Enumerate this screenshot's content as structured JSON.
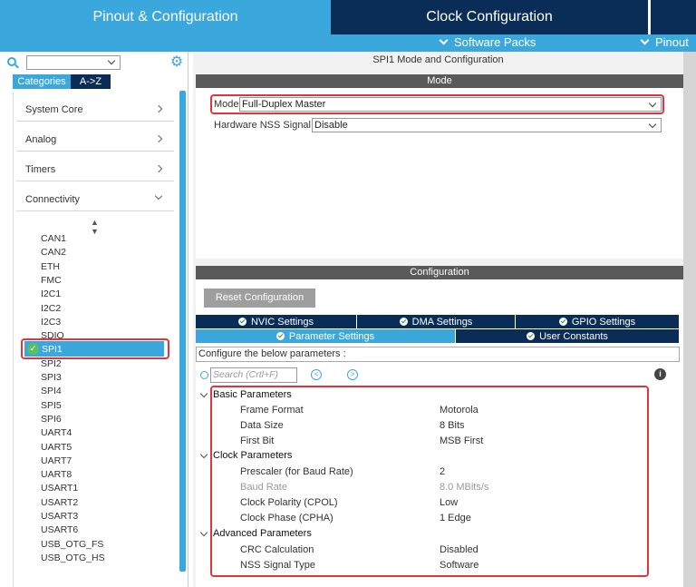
{
  "top_tabs": {
    "pinout": "Pinout & Configuration",
    "clock": "Clock Configuration"
  },
  "subbar": {
    "software_packs": "Software Packs",
    "pinout": "Pinout"
  },
  "left": {
    "categories_label": "Categories",
    "az_label": "A->Z",
    "categories": [
      "System Core",
      "Analog",
      "Timers",
      "Connectivity"
    ],
    "peripherals": [
      "CAN1",
      "CAN2",
      "ETH",
      "FMC",
      "I2C1",
      "I2C2",
      "I2C3",
      "SDIO",
      "SPI1",
      "SPI2",
      "SPI3",
      "SPI4",
      "SPI5",
      "SPI6",
      "UART4",
      "UART5",
      "UART7",
      "UART8",
      "USART1",
      "USART2",
      "USART3",
      "USART6",
      "USB_OTG_FS",
      "USB_OTG_HS"
    ]
  },
  "right": {
    "mode_title": "SPI1 Mode and Configuration",
    "mode_header": "Mode",
    "mode_label": "Mode",
    "mode_value": "Full-Duplex Master",
    "nss_label": "Hardware NSS Signal",
    "nss_value": "Disable",
    "config_header": "Configuration",
    "reset_button": "Reset Configuration",
    "tabs_row1": [
      "NVIC Settings",
      "DMA Settings",
      "GPIO Settings"
    ],
    "tabs_row2": [
      "Parameter Settings",
      "User Constants"
    ],
    "hint": "Configure the below parameters :",
    "search_placeholder": "Search (Crtl+F)",
    "groups": {
      "basic": "Basic Parameters",
      "clock": "Clock Parameters",
      "advanced": "Advanced Parameters"
    },
    "params": [
      {
        "name": "Frame Format",
        "value": "Motorola"
      },
      {
        "name": "Data Size",
        "value": "8 Bits"
      },
      {
        "name": "First Bit",
        "value": "MSB First"
      },
      {
        "name": "Prescaler (for Baud Rate)",
        "value": "2"
      },
      {
        "name": "Baud Rate",
        "value": "8.0 MBits/s"
      },
      {
        "name": "Clock Polarity (CPOL)",
        "value": "Low"
      },
      {
        "name": "Clock Phase (CPHA)",
        "value": "1 Edge"
      },
      {
        "name": "CRC Calculation",
        "value": "Disabled"
      },
      {
        "name": "NSS Signal Type",
        "value": "Software"
      }
    ]
  },
  "colors": {
    "accent": "#3aa8dd",
    "dark": "#0a2d57",
    "highlight": "#e0353c"
  }
}
